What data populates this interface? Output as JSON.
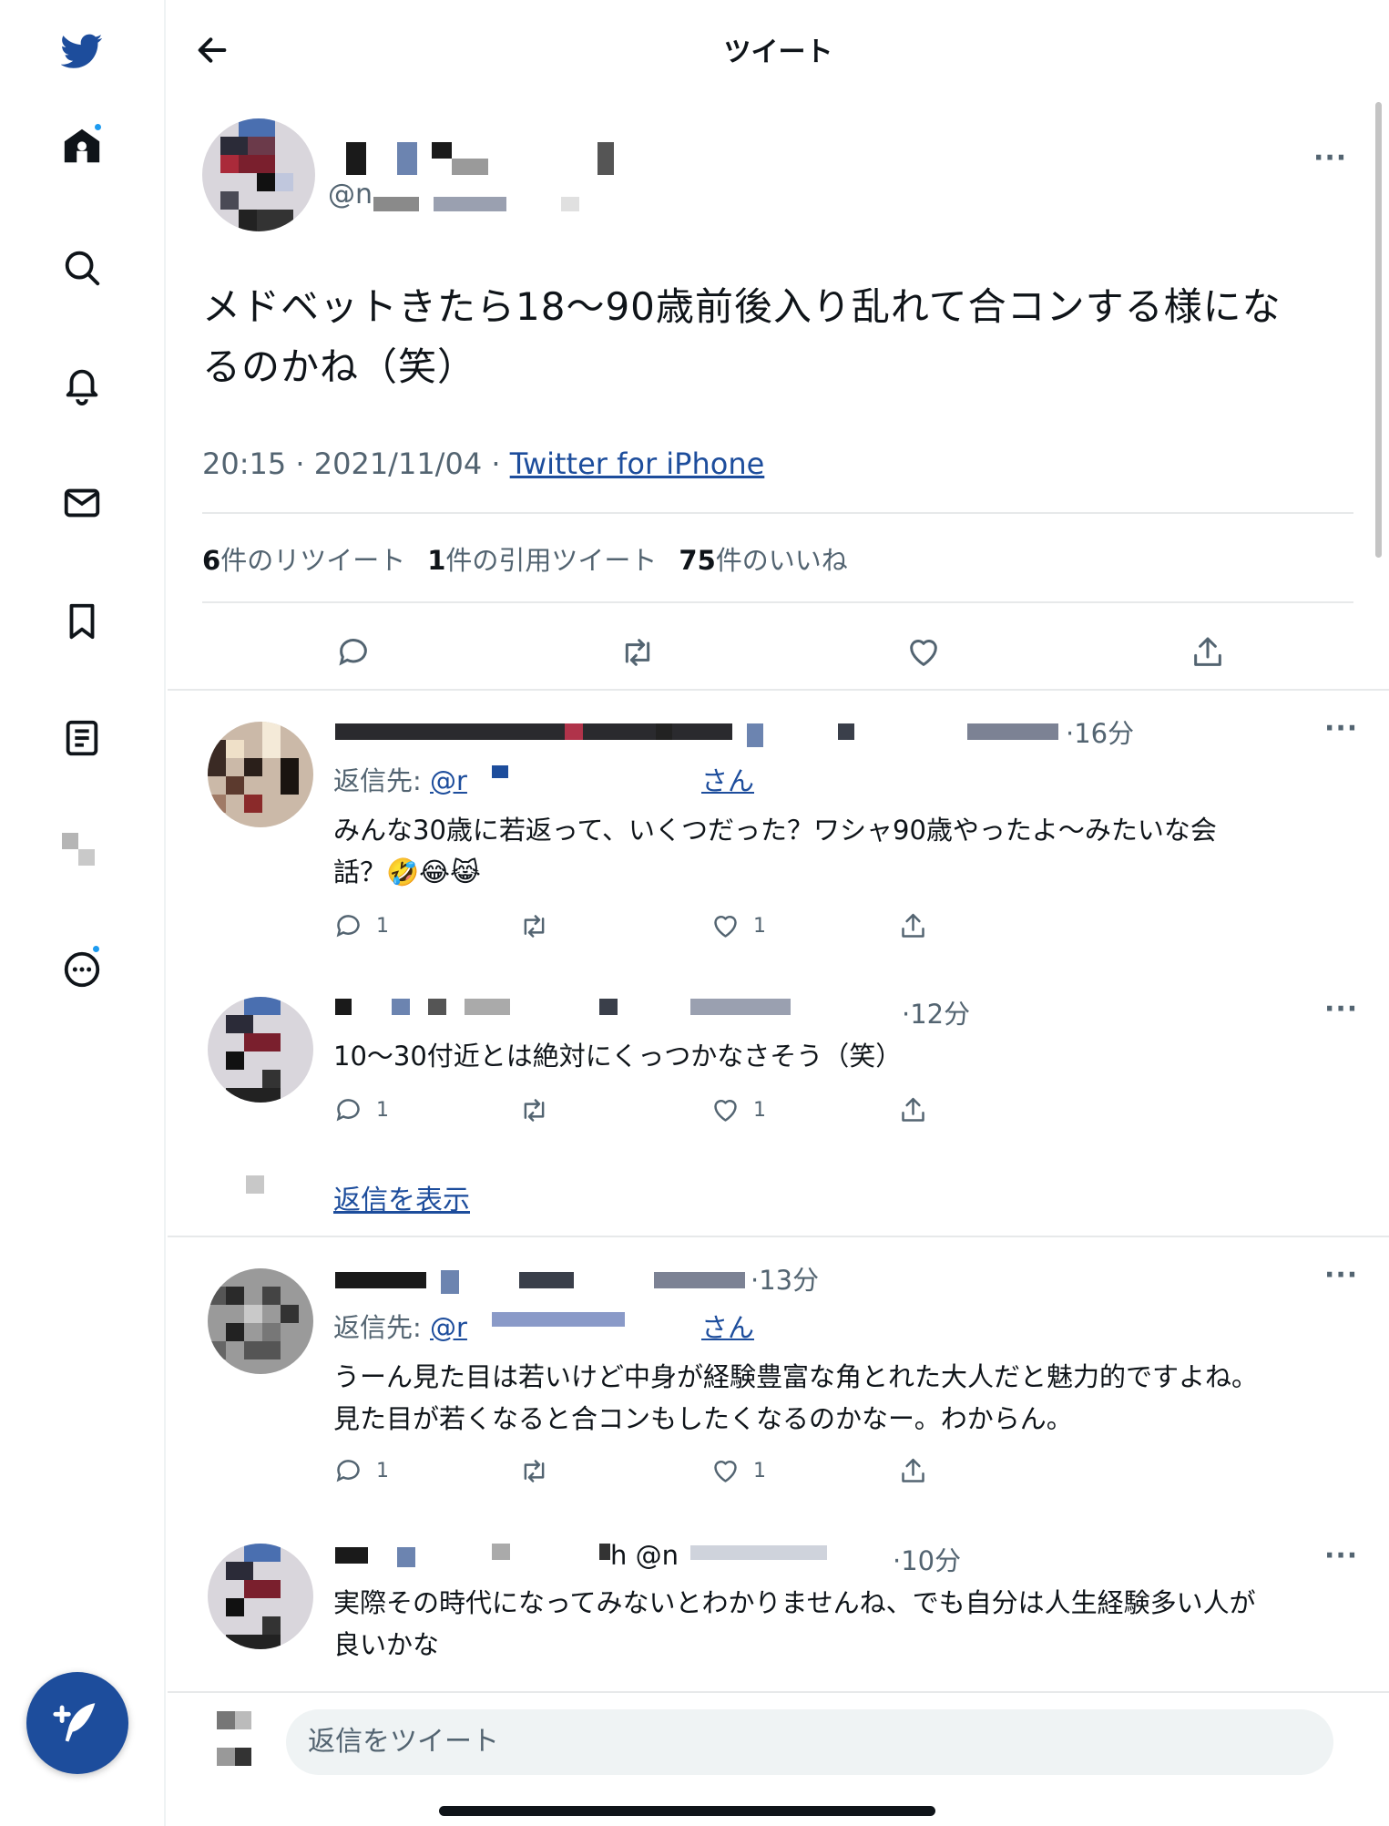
{
  "sidebar": {
    "icons": [
      "twitter-bird-icon",
      "home-icon",
      "search-icon",
      "notifications-icon",
      "messages-icon",
      "bookmarks-icon",
      "lists-icon",
      "profile-icon",
      "more-icon"
    ],
    "compose_icon": "compose-tweet-icon"
  },
  "header": {
    "title": "ツイート",
    "back_icon": "arrow-left-icon"
  },
  "tweet": {
    "handle_prefix": "@n",
    "text_line1": "メドベットきたら18〜90歳前後入り乱れて合コンする様にな",
    "text_line2": "るのかね（笑）",
    "time": "20:15 · 2021/11/04 · ",
    "source": "Twitter for iPhone",
    "stats": {
      "retweets_count": "6",
      "retweets_label": "件のリツイート",
      "quotes_count": "1",
      "quotes_label": "件の引用ツイート",
      "likes_count": "75",
      "likes_label": "件のいいね"
    },
    "more": "···"
  },
  "replies": [
    {
      "time": "·16分",
      "reply_to_label": "返信先: ",
      "reply_to_handle": "@r",
      "reply_to_suffix": "さん",
      "text_line1": "みんな30歳に若返って、いくつだった？ワシャ90歳やったよ〜みたいな会",
      "text_line2": "話？🤣😂😹",
      "reply_count": "1",
      "like_count": "1"
    },
    {
      "time": "·12分",
      "text_line1": "10〜30付近とは絶対にくっつかなさそう（笑）",
      "reply_count": "1",
      "like_count": "1",
      "show_replies": "返信を表示"
    },
    {
      "time": "·13分",
      "reply_to_label": "返信先: ",
      "reply_to_handle": "@r",
      "reply_to_suffix": "さん",
      "text_line1": "うーん見た目は若いけど中身が経験豊富な角とれた大人だと魅力的ですよね。",
      "text_line2": "見た目が若くなると合コンもしたくなるのかなー。わからん。",
      "reply_count": "1",
      "like_count": "1"
    },
    {
      "name_fragment": "h @n",
      "time": "·10分",
      "text_line1": "実際その時代になってみないとわかりませんね、でも自分は人生経験多い人が",
      "text_line2": "良いかな"
    }
  ],
  "reply_bar": {
    "placeholder": "返信をツイート"
  },
  "colors": {
    "accent": "#1d9bf0",
    "link": "#1d4d9c",
    "compose_button": "#1d4d9c",
    "text_secondary": "#536471"
  }
}
